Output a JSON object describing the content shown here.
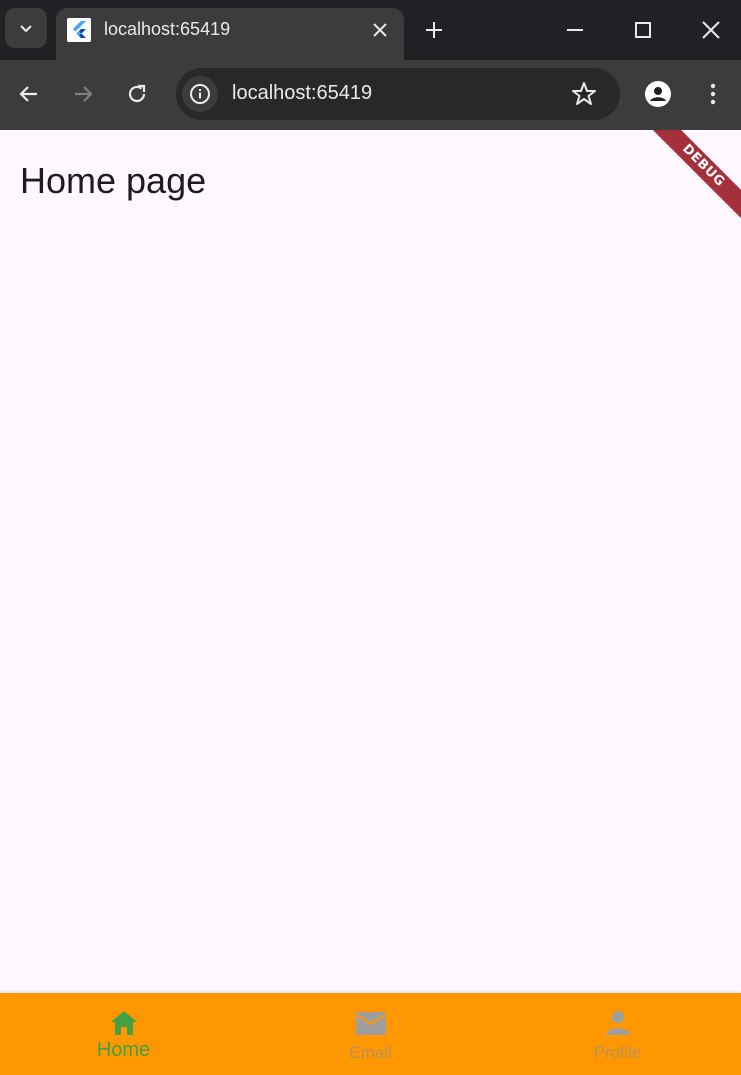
{
  "browser": {
    "tab": {
      "title": "localhost:65419"
    },
    "omnibox": {
      "url": "localhost:65419"
    }
  },
  "page": {
    "title": "Home page",
    "debug_banner": "DEBUG",
    "background": "#fef7ff"
  },
  "bottom_nav": {
    "background": "#ff9800",
    "items": [
      {
        "label": "Home",
        "icon": "home-icon",
        "active": true,
        "color": "#43a047"
      },
      {
        "label": "Email",
        "icon": "email-icon",
        "active": false,
        "color": "#9e9e9e"
      },
      {
        "label": "Profile",
        "icon": "person-icon",
        "active": false,
        "color": "#9e9e9e"
      }
    ]
  }
}
